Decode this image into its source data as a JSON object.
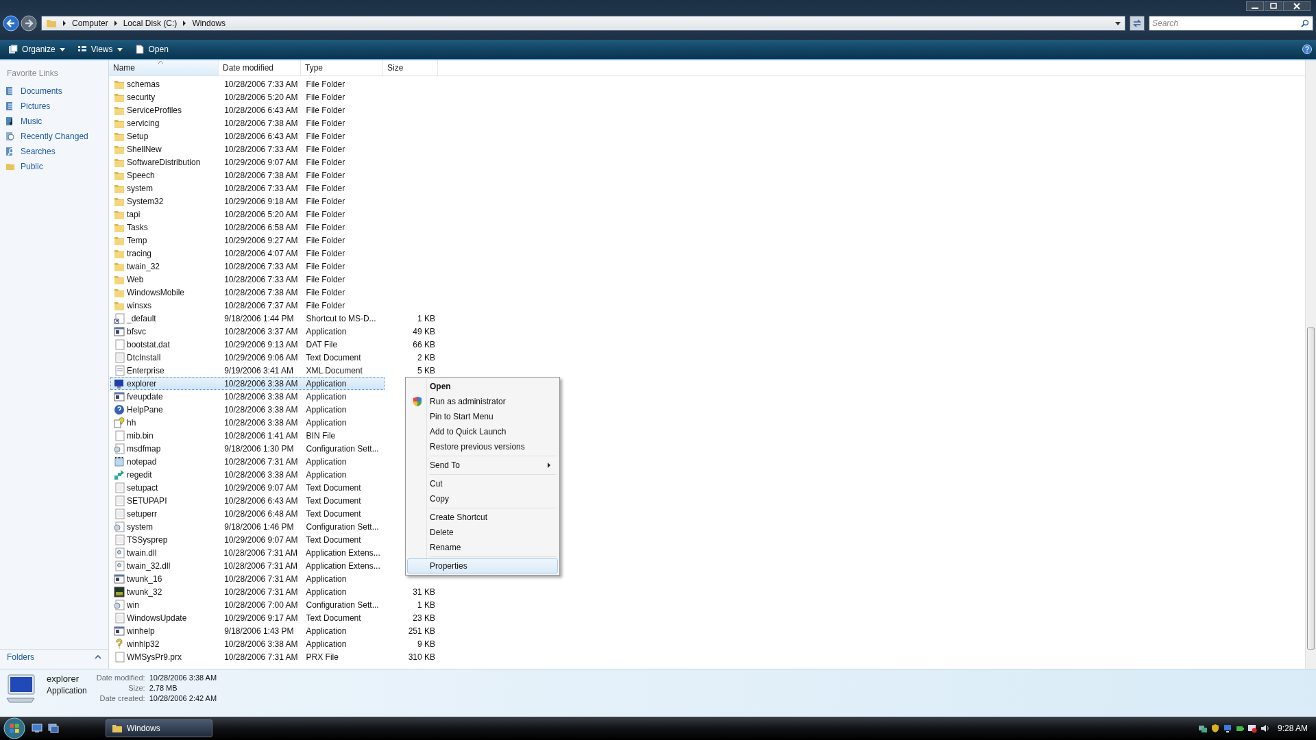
{
  "address": {
    "crumbs": [
      "Computer",
      "Local Disk (C:)",
      "Windows"
    ]
  },
  "search": {
    "placeholder": "Search"
  },
  "toolbar": [
    {
      "label": "Organize",
      "kind": "organize",
      "dropdown": true
    },
    {
      "label": "Views",
      "kind": "views",
      "dropdown": true
    },
    {
      "label": "Open",
      "kind": "open",
      "dropdown": false
    }
  ],
  "sidebar": {
    "heading": "Favorite Links",
    "items": [
      {
        "label": "Documents",
        "kind": "documents"
      },
      {
        "label": "Pictures",
        "kind": "pictures"
      },
      {
        "label": "Music",
        "kind": "music"
      },
      {
        "label": "Recently Changed",
        "kind": "recent"
      },
      {
        "label": "Searches",
        "kind": "searches"
      },
      {
        "label": "Public",
        "kind": "folder"
      }
    ],
    "folders_label": "Folders"
  },
  "table": {
    "columns": [
      {
        "label": "Name",
        "sorted": true
      },
      {
        "label": "Date modified",
        "sorted": false
      },
      {
        "label": "Type",
        "sorted": false
      },
      {
        "label": "Size",
        "sorted": false
      }
    ],
    "rows": [
      {
        "name": "schemas",
        "date": "10/28/2006 7:33 AM",
        "type": "File Folder",
        "kind": "folder",
        "selected": false
      },
      {
        "name": "security",
        "date": "10/28/2006 5:20 AM",
        "type": "File Folder",
        "kind": "folder",
        "selected": false
      },
      {
        "name": "ServiceProfiles",
        "date": "10/28/2006 6:43 AM",
        "type": "File Folder",
        "kind": "folder",
        "selected": false
      },
      {
        "name": "servicing",
        "date": "10/28/2006 7:38 AM",
        "type": "File Folder",
        "kind": "folder",
        "selected": false
      },
      {
        "name": "Setup",
        "date": "10/28/2006 6:43 AM",
        "type": "File Folder",
        "kind": "folder",
        "selected": false
      },
      {
        "name": "ShellNew",
        "date": "10/28/2006 7:33 AM",
        "type": "File Folder",
        "kind": "folder",
        "selected": false
      },
      {
        "name": "SoftwareDistribution",
        "date": "10/29/2006 9:07 AM",
        "type": "File Folder",
        "kind": "folder",
        "selected": false
      },
      {
        "name": "Speech",
        "date": "10/28/2006 7:38 AM",
        "type": "File Folder",
        "kind": "folder",
        "selected": false
      },
      {
        "name": "system",
        "date": "10/28/2006 7:33 AM",
        "type": "File Folder",
        "kind": "folder",
        "selected": false
      },
      {
        "name": "System32",
        "date": "10/29/2006 9:18 AM",
        "type": "File Folder",
        "kind": "folder",
        "selected": false
      },
      {
        "name": "tapi",
        "date": "10/28/2006 5:20 AM",
        "type": "File Folder",
        "kind": "folder",
        "selected": false
      },
      {
        "name": "Tasks",
        "date": "10/28/2006 6:58 AM",
        "type": "File Folder",
        "kind": "folder",
        "selected": false
      },
      {
        "name": "Temp",
        "date": "10/29/2006 9:27 AM",
        "type": "File Folder",
        "kind": "folder",
        "selected": false
      },
      {
        "name": "tracing",
        "date": "10/28/2006 4:07 AM",
        "type": "File Folder",
        "kind": "folder",
        "selected": false
      },
      {
        "name": "twain_32",
        "date": "10/28/2006 7:33 AM",
        "type": "File Folder",
        "kind": "folder",
        "selected": false
      },
      {
        "name": "Web",
        "date": "10/28/2006 7:33 AM",
        "type": "File Folder",
        "kind": "folder",
        "selected": false
      },
      {
        "name": "WindowsMobile",
        "date": "10/28/2006 7:38 AM",
        "type": "File Folder",
        "kind": "folder",
        "selected": false
      },
      {
        "name": "winsxs",
        "date": "10/28/2006 7:37 AM",
        "type": "File Folder",
        "kind": "folder",
        "selected": false
      },
      {
        "name": "_default",
        "date": "9/18/2006 1:44 PM",
        "type": "Shortcut to MS-D...",
        "size": "1 KB",
        "kind": "shortcut",
        "selected": false
      },
      {
        "name": "bfsvc",
        "date": "10/28/2006 3:37 AM",
        "type": "Application",
        "size": "49 KB",
        "kind": "app",
        "selected": false
      },
      {
        "name": "bootstat.dat",
        "date": "10/29/2006 9:13 AM",
        "type": "DAT File",
        "size": "66 KB",
        "kind": "file",
        "selected": false
      },
      {
        "name": "DtcInstall",
        "date": "10/29/2006 9:06 AM",
        "type": "Text Document",
        "size": "2 KB",
        "kind": "text",
        "selected": false
      },
      {
        "name": "Enterprise",
        "date": "9/19/2006 3:41 AM",
        "type": "XML Document",
        "size": "5 KB",
        "kind": "xml",
        "selected": false
      },
      {
        "name": "explorer",
        "date": "10/28/2006 3:38 AM",
        "type": "Application",
        "kind": "monitor",
        "selected": true
      },
      {
        "name": "fveupdate",
        "date": "10/28/2006 3:38 AM",
        "type": "Application",
        "kind": "app",
        "selected": false
      },
      {
        "name": "HelpPane",
        "date": "10/28/2006 3:38 AM",
        "type": "Application",
        "kind": "help",
        "selected": false
      },
      {
        "name": "hh",
        "date": "10/28/2006 3:38 AM",
        "type": "Application",
        "kind": "hh",
        "selected": false
      },
      {
        "name": "mib.bin",
        "date": "10/28/2006 1:41 AM",
        "type": "BIN File",
        "kind": "file",
        "selected": false
      },
      {
        "name": "msdfmap",
        "date": "9/18/2006 1:30 PM",
        "type": "Configuration Sett...",
        "kind": "config",
        "selected": false
      },
      {
        "name": "notepad",
        "date": "10/28/2006 7:31 AM",
        "type": "Application",
        "kind": "notepad",
        "selected": false
      },
      {
        "name": "regedit",
        "date": "10/28/2006 3:38 AM",
        "type": "Application",
        "kind": "regedit",
        "selected": false
      },
      {
        "name": "setupact",
        "date": "10/29/2006 9:07 AM",
        "type": "Text Document",
        "kind": "text",
        "selected": false
      },
      {
        "name": "SETUPAPI",
        "date": "10/28/2006 6:43 AM",
        "type": "Text Document",
        "kind": "text",
        "selected": false
      },
      {
        "name": "setuperr",
        "date": "10/28/2006 6:48 AM",
        "type": "Text Document",
        "kind": "text",
        "selected": false
      },
      {
        "name": "system",
        "date": "9/18/2006 1:46 PM",
        "type": "Configuration Sett...",
        "kind": "config",
        "selected": false
      },
      {
        "name": "TSSysprep",
        "date": "10/29/2006 9:07 AM",
        "type": "Text Document",
        "kind": "text",
        "selected": false
      },
      {
        "name": "twain.dll",
        "date": "10/28/2006 7:31 AM",
        "type": "Application Extens...",
        "kind": "dll",
        "selected": false
      },
      {
        "name": "twain_32.dll",
        "date": "10/28/2006 7:31 AM",
        "type": "Application Extens...",
        "kind": "dll",
        "selected": false
      },
      {
        "name": "twunk_16",
        "date": "10/28/2006 7:31 AM",
        "type": "Application",
        "kind": "app",
        "selected": false
      },
      {
        "name": "twunk_32",
        "date": "10/28/2006 7:31 AM",
        "type": "Application",
        "size": "31 KB",
        "kind": "dark",
        "selected": false
      },
      {
        "name": "win",
        "date": "10/28/2006 7:00 AM",
        "type": "Configuration Sett...",
        "size": "1 KB",
        "kind": "config",
        "selected": false
      },
      {
        "name": "WindowsUpdate",
        "date": "10/29/2006 9:17 AM",
        "type": "Text Document",
        "size": "23 KB",
        "kind": "text",
        "selected": false
      },
      {
        "name": "winhelp",
        "date": "9/18/2006 1:43 PM",
        "type": "Application",
        "size": "251 KB",
        "kind": "app",
        "selected": false
      },
      {
        "name": "winhlp32",
        "date": "10/28/2006 3:38 AM",
        "type": "Application",
        "size": "9 KB",
        "kind": "question",
        "selected": false
      },
      {
        "name": "WMSysPr9.prx",
        "date": "10/28/2006 7:31 AM",
        "type": "PRX File",
        "size": "310 KB",
        "kind": "file",
        "selected": false
      }
    ]
  },
  "context_menu": {
    "groups": [
      [
        {
          "label": "Open",
          "default": true,
          "shield": false,
          "submenu": false,
          "selected": false
        },
        {
          "label": "Run as administrator",
          "default": false,
          "shield": true,
          "submenu": false,
          "selected": false
        },
        {
          "label": "Pin to Start Menu",
          "default": false,
          "shield": false,
          "submenu": false,
          "selected": false
        },
        {
          "label": "Add to Quick Launch",
          "default": false,
          "shield": false,
          "submenu": false,
          "selected": false
        },
        {
          "label": "Restore previous versions",
          "default": false,
          "shield": false,
          "submenu": false,
          "selected": false
        }
      ],
      [
        {
          "label": "Send To",
          "default": false,
          "shield": false,
          "submenu": true,
          "selected": false
        }
      ],
      [
        {
          "label": "Cut",
          "default": false,
          "shield": false,
          "submenu": false,
          "selected": false
        },
        {
          "label": "Copy",
          "default": false,
          "shield": false,
          "submenu": false,
          "selected": false
        }
      ],
      [
        {
          "label": "Create Shortcut",
          "default": false,
          "shield": false,
          "submenu": false,
          "selected": false
        },
        {
          "label": "Delete",
          "default": false,
          "shield": false,
          "submenu": false,
          "selected": false
        },
        {
          "label": "Rename",
          "default": false,
          "shield": false,
          "submenu": false,
          "selected": false
        }
      ],
      [
        {
          "label": "Properties",
          "default": false,
          "shield": false,
          "submenu": false,
          "selected": true
        }
      ]
    ]
  },
  "details": {
    "name": "explorer",
    "type": "Application",
    "fields": [
      {
        "label": "Date modified:",
        "value": "10/28/2006 3:38 AM"
      },
      {
        "label": "Size:",
        "value": "2.78 MB"
      },
      {
        "label": "Date created:",
        "value": "10/28/2006 2:42 AM"
      }
    ]
  },
  "taskbar": {
    "tasks": [
      {
        "label": "Windows",
        "selected": true
      }
    ],
    "clock": "9:28 AM"
  }
}
